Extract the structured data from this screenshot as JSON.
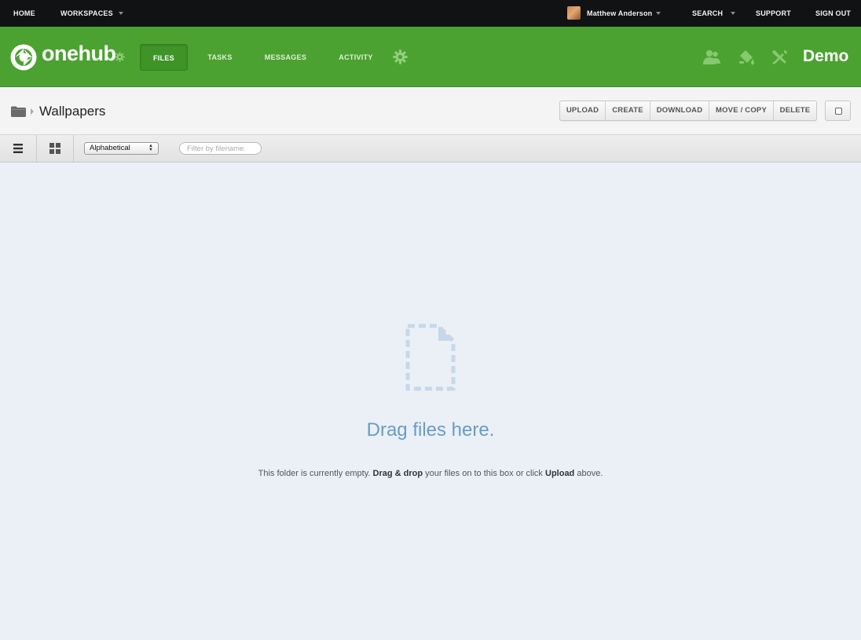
{
  "topbar": {
    "home": "HOME",
    "workspaces": "WORKSPACES",
    "user": "Matthew Anderson",
    "search": "SEARCH",
    "support": "SUPPORT",
    "signout": "SIGN OUT"
  },
  "header": {
    "logo_text": "onehub",
    "tabs": [
      {
        "label": "FILES",
        "active": true
      },
      {
        "label": "TASKS",
        "active": false
      },
      {
        "label": "MESSAGES",
        "active": false
      },
      {
        "label": "ACTIVITY",
        "active": false
      }
    ],
    "workspace_name": "Demo",
    "icons": [
      "settings-gear-icon",
      "members-icon",
      "paint-bucket-icon",
      "tools-icon"
    ]
  },
  "breadcrumb": {
    "icon": "folder-icon",
    "title": "Wallpapers"
  },
  "actions": [
    "UPLOAD",
    "CREATE",
    "DOWNLOAD",
    "MOVE / COPY",
    "DELETE"
  ],
  "toolbar": {
    "sort_selected": "Alphabetical",
    "filter_placeholder": "Filter by filename.",
    "views": [
      "list-view-icon",
      "grid-view-icon"
    ]
  },
  "dropzone": {
    "title": "Drag files here.",
    "sub_prefix": "This folder is currently empty.",
    "sub_bold1": "Drag & drop",
    "sub_middle": "your files on to this box or click",
    "sub_bold2": "Upload",
    "sub_suffix": "above."
  },
  "colors": {
    "header_green": "#4ba230",
    "topbar": "#111214",
    "dropzone_bg": "#eaf0f6",
    "drag_text": "#6b9bc6"
  }
}
